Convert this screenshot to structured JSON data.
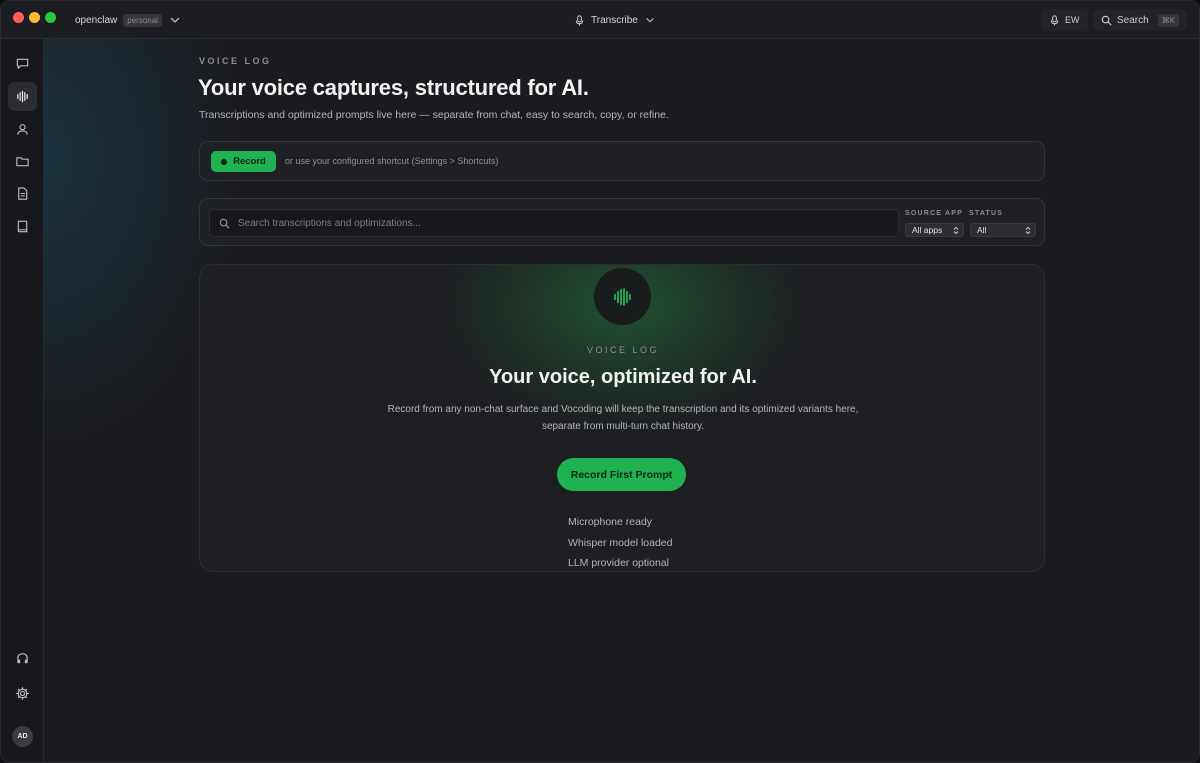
{
  "titlebar": {
    "workspace_name": "openclaw",
    "workspace_badge": "personal",
    "transcribe_label": "Transcribe",
    "mic_indicator": "EW",
    "search_label": "Search",
    "search_shortcut": "⌘K"
  },
  "sidebar": {
    "items": [
      {
        "name": "chat",
        "icon": "chat-bubble-icon"
      },
      {
        "name": "voice-log",
        "icon": "waveform-icon",
        "active": true
      },
      {
        "name": "contacts",
        "icon": "person-icon"
      },
      {
        "name": "folders",
        "icon": "folder-icon"
      },
      {
        "name": "documents",
        "icon": "document-icon"
      },
      {
        "name": "library",
        "icon": "book-icon"
      }
    ],
    "bottom": [
      {
        "name": "support",
        "icon": "headphones-icon"
      },
      {
        "name": "settings",
        "icon": "gear-icon"
      }
    ],
    "avatar_initials": "AD"
  },
  "page": {
    "eyebrow": "VOICE LOG",
    "title": "Your voice captures, structured for AI.",
    "subtitle": "Transcriptions and optimized prompts live here — separate from chat, easy to search, copy, or refine."
  },
  "record_bar": {
    "button_label": "Record",
    "hint": "or use your configured shortcut (Settings > Shortcuts)"
  },
  "filters": {
    "search_placeholder": "Search transcriptions and optimizations...",
    "source_app_label": "SOURCE APP",
    "source_app_value": "All apps",
    "status_label": "STATUS",
    "status_value": "All"
  },
  "empty_state": {
    "eyebrow": "VOICE LOG",
    "title": "Your voice, optimized for AI.",
    "description": "Record from any non-chat surface and Vocoding will keep the transcription and its optimized variants here, separate from multi-turn chat history.",
    "cta_label": "Record First Prompt",
    "status_items": [
      "Microphone ready",
      "Whisper model loaded",
      "LLM provider optional"
    ]
  },
  "colors": {
    "accent_green": "#1eb251",
    "background": "#1a1b1e",
    "surface": "#1f2023"
  }
}
